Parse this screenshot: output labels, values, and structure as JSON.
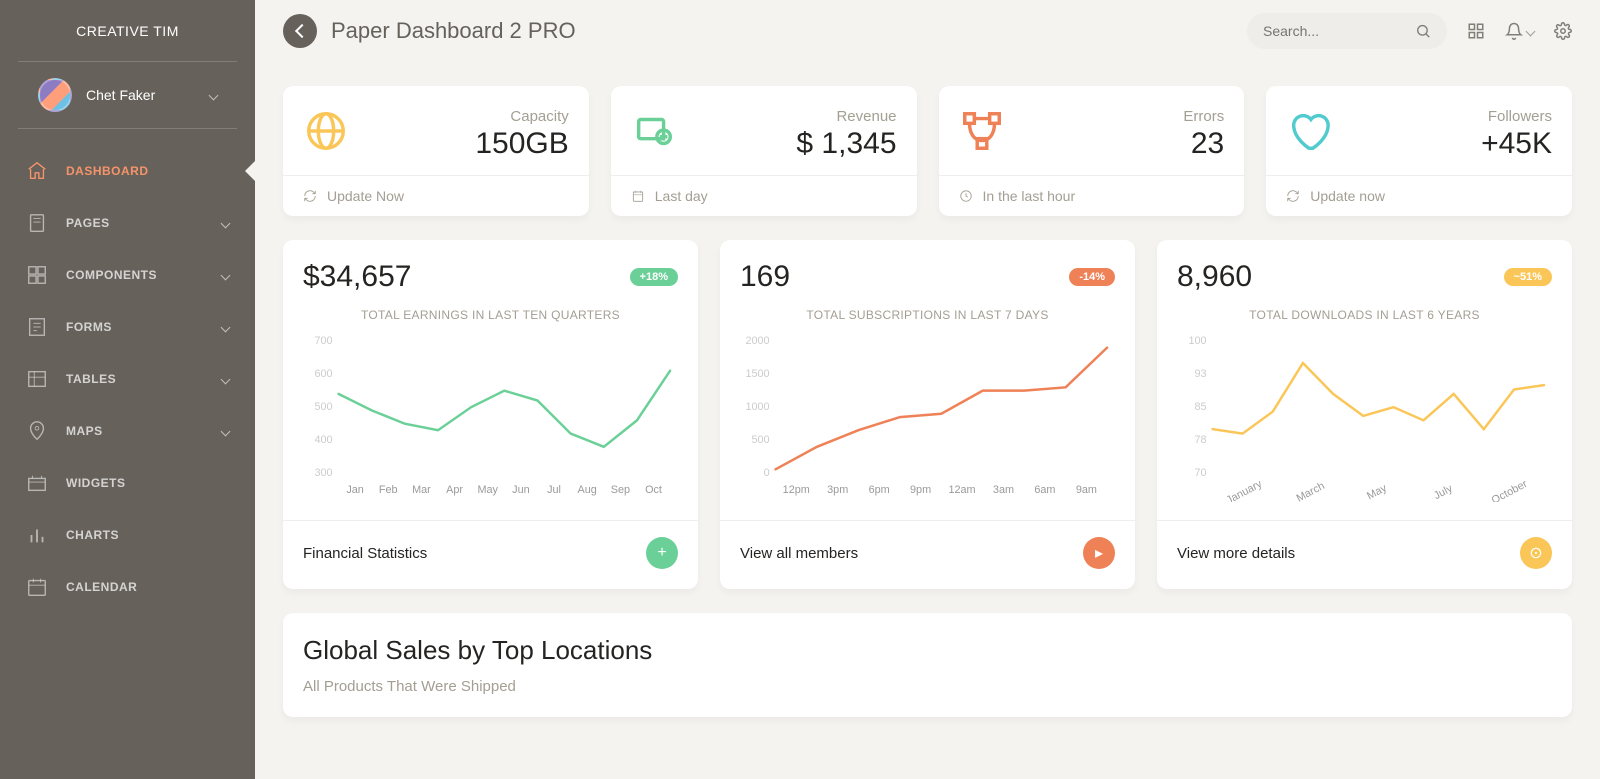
{
  "brand": "CREATIVE TIM",
  "user": {
    "name": "Chet Faker"
  },
  "page_title": "Paper Dashboard 2 PRO",
  "search": {
    "placeholder": "Search..."
  },
  "sidebar": [
    {
      "label": "DASHBOARD",
      "expandable": false,
      "active": true
    },
    {
      "label": "PAGES",
      "expandable": true,
      "active": false
    },
    {
      "label": "COMPONENTS",
      "expandable": true,
      "active": false
    },
    {
      "label": "FORMS",
      "expandable": true,
      "active": false
    },
    {
      "label": "TABLES",
      "expandable": true,
      "active": false
    },
    {
      "label": "MAPS",
      "expandable": true,
      "active": false
    },
    {
      "label": "WIDGETS",
      "expandable": false,
      "active": false
    },
    {
      "label": "CHARTS",
      "expandable": false,
      "active": false
    },
    {
      "label": "CALENDAR",
      "expandable": false,
      "active": false
    }
  ],
  "stats": [
    {
      "label": "Capacity",
      "value": "150GB",
      "footer": "Update Now",
      "icon": "globe",
      "color": "#fbc658"
    },
    {
      "label": "Revenue",
      "value": "$ 1,345",
      "footer": "Last day",
      "icon": "wallet",
      "color": "#6bd098"
    },
    {
      "label": "Errors",
      "value": "23",
      "footer": "In the last hour",
      "icon": "vector",
      "color": "#ef8157"
    },
    {
      "label": "Followers",
      "value": "+45K",
      "footer": "Update now",
      "icon": "heart",
      "color": "#51cbce"
    }
  ],
  "charts": [
    {
      "number": "$34,657",
      "badge": "+18%",
      "badge_color": "bg-green",
      "subtitle": "TOTAL EARNINGS IN LAST TEN QUARTERS",
      "footer": "Financial Statistics",
      "fab_color": "#6bd098",
      "fab_icon": "plus"
    },
    {
      "number": "169",
      "badge": "-14%",
      "badge_color": "bg-orange",
      "subtitle": "TOTAL SUBSCRIPTIONS IN LAST 7 DAYS",
      "footer": "View all members",
      "fab_color": "#ef8157",
      "fab_icon": "play"
    },
    {
      "number": "8,960",
      "badge": "~51%",
      "badge_color": "bg-yellow",
      "subtitle": "TOTAL DOWNLOADS IN LAST 6 YEARS",
      "footer": "View more details",
      "fab_color": "#fbc658",
      "fab_icon": "info"
    }
  ],
  "chart_data": [
    {
      "type": "line",
      "title": "TOTAL EARNINGS IN LAST TEN QUARTERS",
      "ylim": [
        300,
        700
      ],
      "categories": [
        "Jan",
        "Feb",
        "Mar",
        "Apr",
        "May",
        "Jun",
        "Jul",
        "Aug",
        "Sep",
        "Oct"
      ],
      "values": [
        540,
        490,
        450,
        430,
        500,
        550,
        520,
        420,
        380,
        460,
        610
      ],
      "stroke": "#6bd098"
    },
    {
      "type": "line",
      "title": "TOTAL SUBSCRIPTIONS IN LAST 7 DAYS",
      "ylim": [
        0,
        2000
      ],
      "categories": [
        "12pm",
        "3pm",
        "6pm",
        "9pm",
        "12am",
        "3am",
        "6am",
        "9am"
      ],
      "values": [
        60,
        400,
        650,
        850,
        900,
        1250,
        1250,
        1300,
        1900
      ],
      "stroke": "#ef8157"
    },
    {
      "type": "line",
      "title": "TOTAL DOWNLOADS IN LAST 6 YEARS",
      "ylim": [
        70,
        100
      ],
      "categories": [
        "January",
        "March",
        "May",
        "July",
        "October"
      ],
      "values": [
        80,
        79,
        84,
        95,
        88,
        83,
        85,
        82,
        88,
        80,
        89,
        90
      ],
      "stroke": "#fbc658"
    }
  ],
  "global_sales": {
    "title": "Global Sales by Top Locations",
    "subtitle": "All Products That Were Shipped"
  }
}
